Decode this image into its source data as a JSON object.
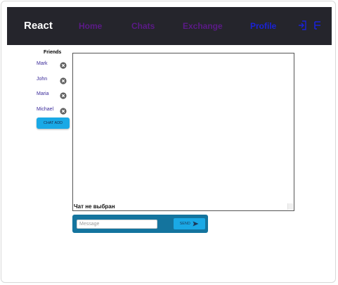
{
  "navbar": {
    "brand": "React",
    "links": [
      {
        "label": "Home"
      },
      {
        "label": "Chats"
      },
      {
        "label": "Exchange"
      },
      {
        "label": "Profile"
      }
    ],
    "active_link": "Profile",
    "icons": [
      "login-icon",
      "menu-icon"
    ]
  },
  "friends": {
    "title": "Friends",
    "items": [
      {
        "name": "Mark"
      },
      {
        "name": "John"
      },
      {
        "name": "Maria"
      },
      {
        "name": "Michael"
      }
    ],
    "remove_icon": "remove-circle-icon",
    "add_button": "CHAT ADD"
  },
  "chat": {
    "status": "Чат не выбран"
  },
  "composer": {
    "message_value": "",
    "message_placeholder": "Message",
    "send_label": "SEND",
    "send_icon": "send-arrow-icon"
  },
  "colors": {
    "navbar_bg": "#25252c",
    "nav_link": "#5b1a87",
    "nav_link_active": "#1a22d6",
    "accent": "#1aa9e6",
    "composer_bg": "#14749e"
  }
}
